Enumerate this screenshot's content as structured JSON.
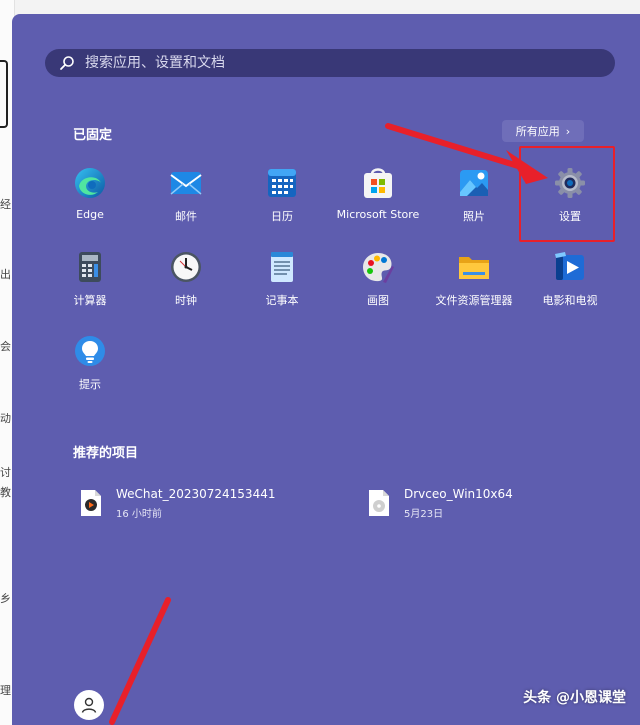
{
  "search": {
    "placeholder": "搜索应用、设置和文档"
  },
  "pinned": {
    "title": "已固定",
    "all_apps_label": "所有应用",
    "all_apps_chevron": "›",
    "apps": [
      {
        "label": "Edge",
        "icon": "edge-icon"
      },
      {
        "label": "邮件",
        "icon": "mail-icon"
      },
      {
        "label": "日历",
        "icon": "calendar-icon"
      },
      {
        "label": "Microsoft Store",
        "icon": "store-icon"
      },
      {
        "label": "照片",
        "icon": "photos-icon"
      },
      {
        "label": "设置",
        "icon": "settings-gear-icon"
      },
      {
        "label": "计算器",
        "icon": "calculator-icon"
      },
      {
        "label": "时钟",
        "icon": "clock-icon"
      },
      {
        "label": "记事本",
        "icon": "notepad-icon"
      },
      {
        "label": "画图",
        "icon": "paint-icon"
      },
      {
        "label": "文件资源管理器",
        "icon": "file-explorer-icon"
      },
      {
        "label": "电影和电视",
        "icon": "movies-tv-icon"
      },
      {
        "label": "提示",
        "icon": "tips-icon"
      }
    ]
  },
  "recommended": {
    "title": "推荐的项目",
    "items": [
      {
        "name": "WeChat_20230724153441",
        "time": "16 小时前",
        "icon": "video-file-icon"
      },
      {
        "name": "Drvceo_Win10x64",
        "time": "5月23日",
        "icon": "disc-image-icon"
      }
    ]
  },
  "watermark": "头条 @小恩课堂",
  "background_fragments": [
    "经",
    "出",
    "会",
    "动",
    "讨",
    "教",
    "乡",
    "理"
  ],
  "colors": {
    "panel": "#5e5daf",
    "search": "#393877",
    "highlight": "#e8202a"
  }
}
